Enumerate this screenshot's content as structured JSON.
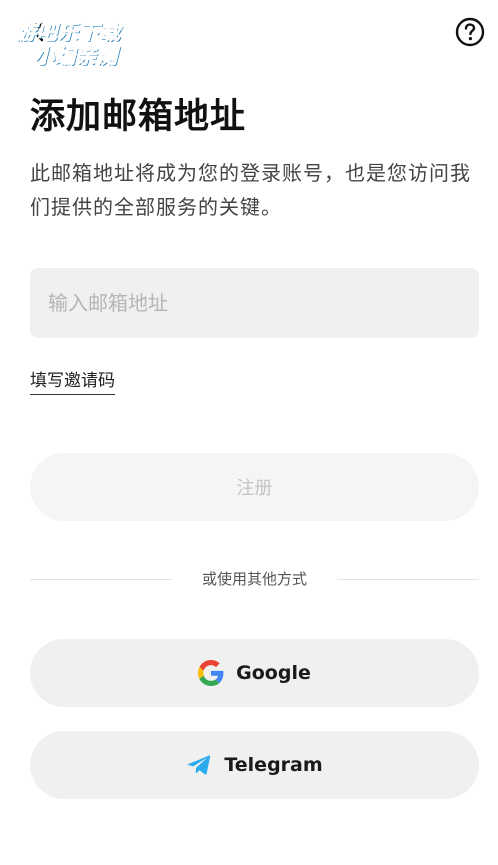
{
  "watermark": {
    "line1": "游吧乐下载",
    "line2": "小编亲测"
  },
  "header": {
    "back_icon": "chevron-left-icon",
    "help_icon": "question-circle-icon"
  },
  "title": "添加邮箱地址",
  "subtitle": "此邮箱地址将成为您的登录账号，也是您访问我们提供的全部服务的关键。",
  "email_input": {
    "value": "",
    "placeholder": "输入邮箱地址"
  },
  "invite_link": "填写邀请码",
  "register_button": {
    "label": "注册",
    "state": "disabled"
  },
  "divider_text": "或使用其他方式",
  "social": {
    "google": {
      "label": "Google",
      "icon": "google-icon"
    },
    "telegram": {
      "label": "Telegram",
      "icon": "telegram-icon"
    }
  },
  "colors": {
    "field_bg": "#f0f0f0",
    "register_disabled_bg": "#f5f5f5",
    "register_disabled_text": "#c4c4c4",
    "telegram_blue": "#2AABEE",
    "watermark_blue": "#1da7f2"
  }
}
